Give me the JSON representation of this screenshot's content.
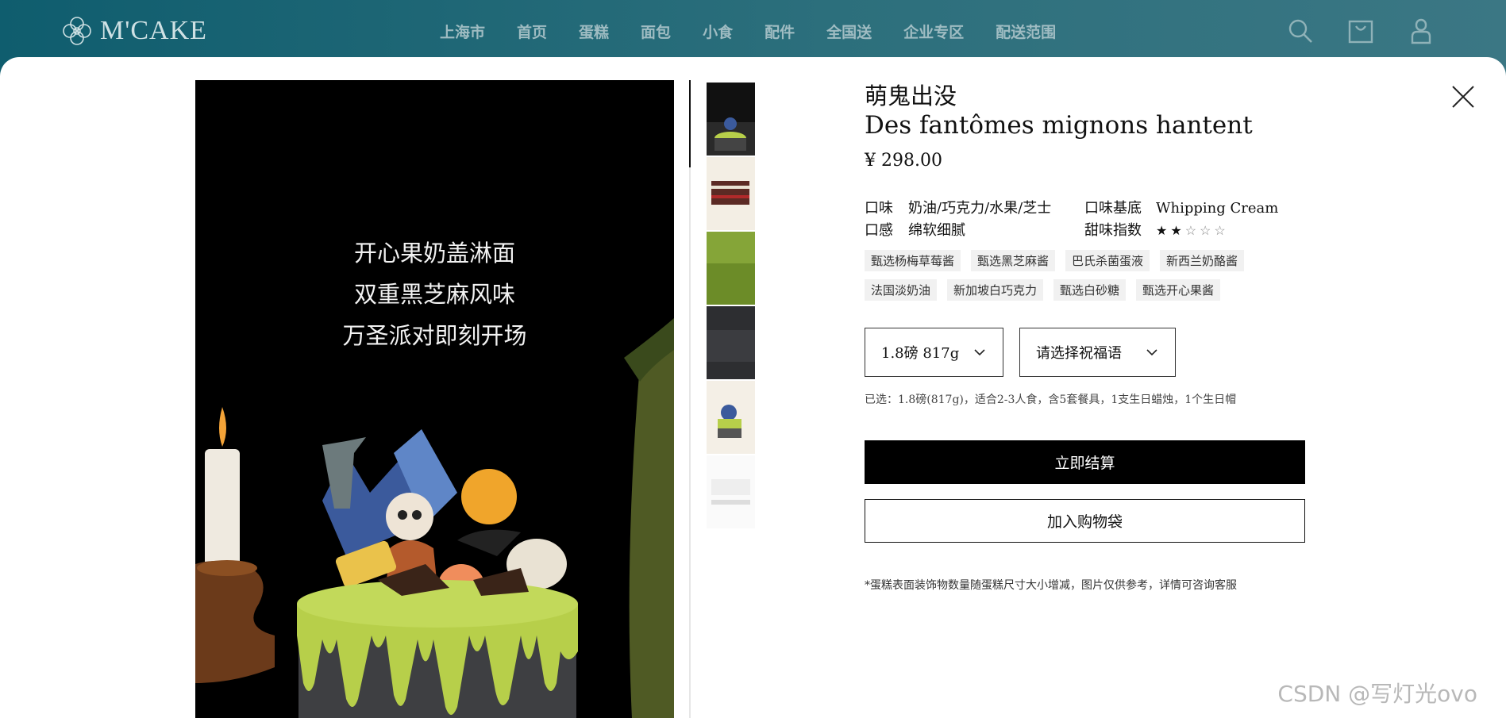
{
  "brand": {
    "logo_text": "M'CAKE"
  },
  "nav": {
    "items": [
      "上海市",
      "首页",
      "蛋糕",
      "面包",
      "小食",
      "配件",
      "全国送",
      "企业专区",
      "配送范围"
    ],
    "icons": [
      "search-icon",
      "shopping-bag-icon",
      "user-icon"
    ]
  },
  "product": {
    "title_cn": "萌鬼出没",
    "title_fr": "Des fantômes mignons hantent",
    "price": "¥ 298.00",
    "attributes": {
      "flavor_label": "口味",
      "flavor_value": "奶油/巧克力/水果/芝士",
      "base_label": "口味基底",
      "base_value": "Whipping Cream",
      "texture_label": "口感",
      "texture_value": "绵软细腻",
      "sweetness_label": "甜味指数",
      "sweetness_rating": 2,
      "sweetness_max": 5
    },
    "ingredients": [
      "甄选杨梅草莓酱",
      "甄选黑芝麻酱",
      "巴氏杀菌蛋液",
      "新西兰奶酪酱",
      "法国淡奶油",
      "新加坡白巧克力",
      "甄选白砂糖",
      "甄选开心果酱"
    ],
    "size_select": "1.8磅 817g",
    "greeting_select": "请选择祝福语",
    "selected_info": "已选：1.8磅(817g)，适合2-3人食，含5套餐具，1支生日蜡烛，1个生日帽",
    "checkout_label": "立即结算",
    "add_to_bag_label": "加入购物袋",
    "note": "*蛋糕表面装饰物数量随蛋糕尺寸大小增减，图片仅供参考，详情可咨询客服"
  },
  "image": {
    "caption_lines": [
      "开心果奶盖淋面",
      "双重黑芝麻风味",
      "万圣派对即刻开场"
    ],
    "thumbnail_count": 6
  },
  "watermark": "CSDN @写灯光ovo",
  "colors": {
    "nav_bg": "#1a6271",
    "accent": "#000000",
    "icing": "#b7cf4a"
  }
}
